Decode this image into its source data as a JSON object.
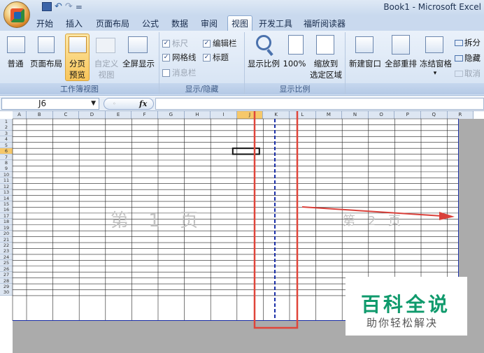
{
  "window": {
    "title": "Book1 - Microsoft Excel"
  },
  "qat": {
    "save_icon": "save-icon",
    "undo_icon": "undo-icon",
    "redo_icon": "redo-icon",
    "customize": "="
  },
  "tabs": [
    {
      "label": "开始"
    },
    {
      "label": "插入"
    },
    {
      "label": "页面布局"
    },
    {
      "label": "公式"
    },
    {
      "label": "数据"
    },
    {
      "label": "审阅"
    },
    {
      "label": "视图",
      "active": true
    },
    {
      "label": "开发工具"
    },
    {
      "label": "福昕阅读器"
    }
  ],
  "ribbon": {
    "group1": {
      "label": "工作簿视图",
      "normal": "普通",
      "page_layout": "页面布局",
      "page_break_1": "分页",
      "page_break_2": "预览",
      "custom_1": "自定义",
      "custom_2": "视图",
      "fullscreen": "全屏显示"
    },
    "group2": {
      "label": "显示/隐藏",
      "ruler": "标尺",
      "formula_bar": "编辑栏",
      "gridlines": "网格线",
      "headings": "标题",
      "message_bar": "消息栏"
    },
    "group3": {
      "label": "显示比例",
      "zoom": "显示比例",
      "zoom100": "100%",
      "zoom_sel_1": "缩放到",
      "zoom_sel_2": "选定区域"
    },
    "group4": {
      "new_window": "新建窗口",
      "arrange_all": "全部重排",
      "freeze": "冻结窗格",
      "split": "拆分",
      "hide": "隐藏",
      "unhide": "取消"
    }
  },
  "formula_bar": {
    "name_box": "J6",
    "fx": "fx"
  },
  "sheet": {
    "columns": [
      "A",
      "B",
      "C",
      "D",
      "E",
      "F",
      "G",
      "H",
      "I",
      "J",
      "K",
      "L",
      "M",
      "N",
      "O",
      "P",
      "Q",
      "R"
    ],
    "selected_column": "J",
    "rows": [
      "1",
      "2",
      "3",
      "4",
      "5",
      "6",
      "7",
      "8",
      "9",
      "10",
      "11",
      "12",
      "13",
      "14",
      "15",
      "16",
      "17",
      "18",
      "19",
      "20",
      "21",
      "22",
      "23",
      "24",
      "25",
      "26",
      "27",
      "28",
      "29",
      "30"
    ],
    "selected_row": "6",
    "page1_label": "第 1 页",
    "page2_label": "第 2 页"
  },
  "annotation": {
    "box_color": "#e0453a",
    "arrow_color": "#d9403a"
  },
  "watermark": {
    "title": "百科全说",
    "subtitle": "助你轻松解决"
  },
  "colors": {
    "page_break_line": "#1a2fa8",
    "ribbon_bg": "#d4e2f3",
    "selection": "#f6c86a"
  }
}
